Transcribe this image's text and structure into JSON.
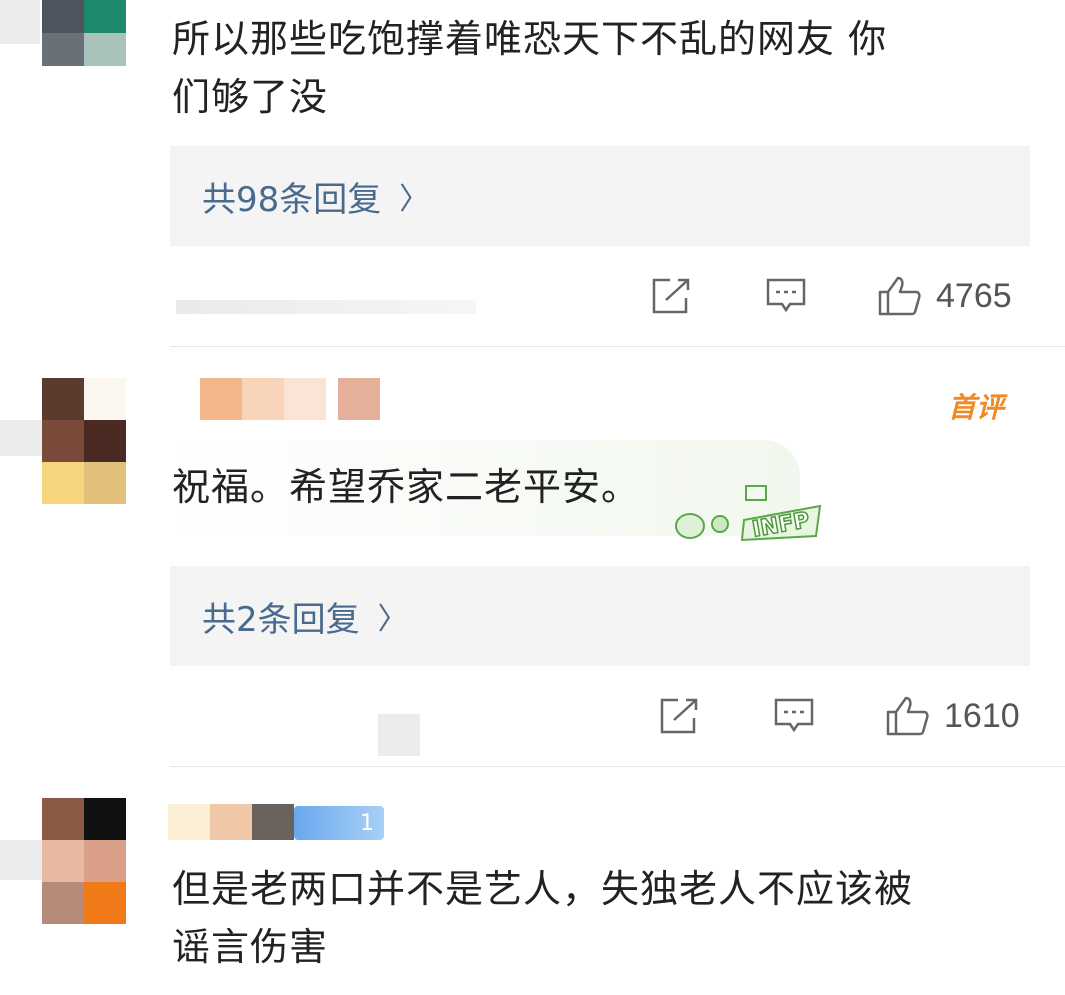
{
  "comments": [
    {
      "text_line1": "所以那些吃饱撑着唯恐天下不乱的网友 你",
      "text_line2": "们够了没",
      "replies_label": "共98条回复",
      "likes": "4765"
    },
    {
      "badge": "首评",
      "text_line1": "祝福。希望乔家二老平安。",
      "sticker": "INFP",
      "replies_label": "共2条回复",
      "likes": "1610"
    },
    {
      "level_badge": "1",
      "text_line1": "但是老两口并不是艺人，失独老人不应该被",
      "text_line2": "谣言伤害"
    }
  ],
  "icons": {
    "share": "share-icon",
    "comment": "comment-icon",
    "like": "thumbs-up-icon",
    "chevron": "chevron-right-icon"
  },
  "colors": {
    "reply_link": "#4a6a8d",
    "first_badge": "#f08a28",
    "reply_box_bg": "#f4f4f4"
  }
}
